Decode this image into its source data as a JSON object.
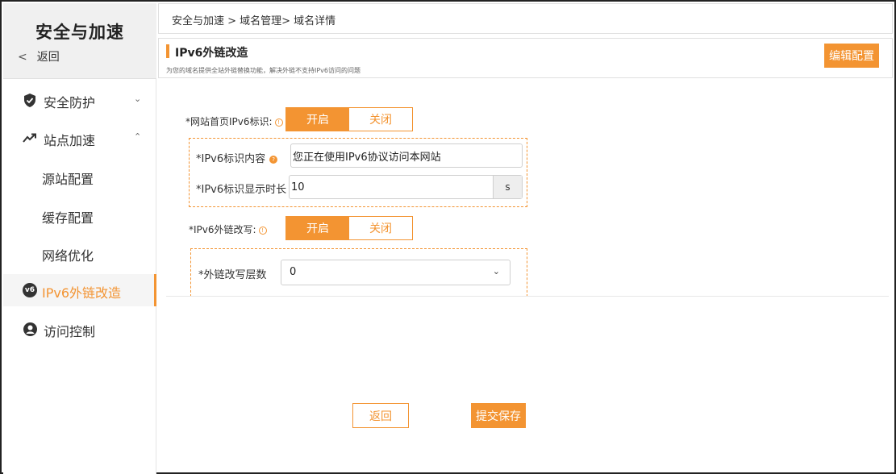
{
  "sidebar": {
    "title": "安全与加速",
    "back_label": "返回",
    "items": [
      {
        "label": "安全防护",
        "icon": "shield-icon"
      },
      {
        "label": "站点加速",
        "icon": "trend-up-icon"
      },
      {
        "label": "源站配置"
      },
      {
        "label": "缓存配置"
      },
      {
        "label": "网络优化"
      },
      {
        "label": "IPv6外链改造",
        "icon": "v6-icon",
        "badge": "v6"
      },
      {
        "label": "访问控制",
        "icon": "user-circle-icon"
      }
    ]
  },
  "breadcrumb": "安全与加速 > 域名管理> 域名详情",
  "section": {
    "title": "IPv6外链改造",
    "description": "为您的域名提供全站外链替换功能，解决外链不支持IPv6访问的问题",
    "edit_label": "编辑配置"
  },
  "form": {
    "homepage_tag_label": "*网站首页IPv6标识:",
    "homepage_tag_on": "开启",
    "homepage_tag_off": "关闭",
    "tag_content_label": "*IPv6标识内容",
    "tag_content_value": "您正在使用IPv6协议访问本网站",
    "tag_duration_label": "*IPv6标识显示时长",
    "tag_duration_value": "10",
    "tag_duration_unit": "s",
    "rewrite_label": "*IPv6外链改写:",
    "rewrite_on": "开启",
    "rewrite_off": "关闭",
    "depth_label": "*外链改写层数",
    "depth_value": "0"
  },
  "footer": {
    "back_label": "返回",
    "submit_label": "提交保存"
  },
  "colors": {
    "accent": "#f39432"
  }
}
